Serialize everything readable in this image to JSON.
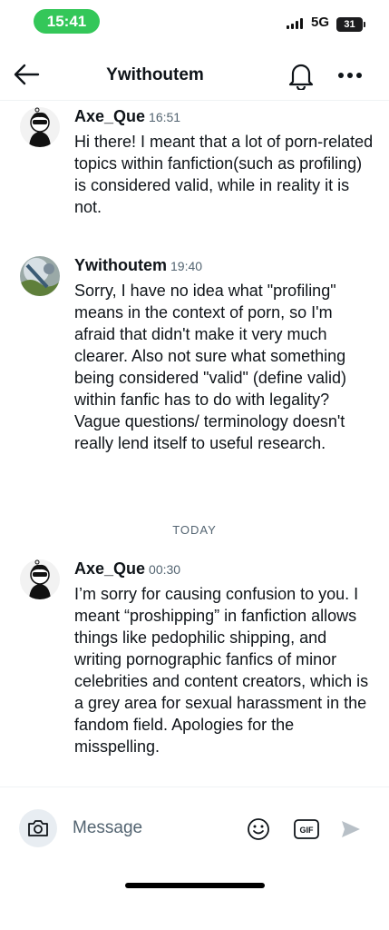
{
  "status_bar": {
    "time": "15:41",
    "network": "5G",
    "battery": "31"
  },
  "header": {
    "title": "Ywithoutem",
    "icons": [
      "back-arrow-icon",
      "bell-icon",
      "more-horizontal-icon"
    ]
  },
  "messages": [
    {
      "sender": "Axe_Que",
      "time": "16:51",
      "text": "Hi there! I meant that a lot of porn-related topics within fanfiction(such as profiling) is considered valid, while in reality it is not."
    },
    {
      "sender": "Ywithoutem",
      "time": "19:40",
      "text": "Sorry, I have no idea what \"profiling\" means in the context of porn, so I'm afraid that didn't make it very much clearer. Also not sure what something being considered \"valid\" (define valid) within fanfic has to do with legality? Vague questions/ terminology doesn't really lend itself to useful research."
    },
    {
      "sender": "Axe_Que",
      "time": "00:30",
      "text": "I’m sorry for causing confusion to you. I meant “proshipping” in fanfiction allows things like pedophilic shipping, and writing pornographic fanfics of minor celebrities and content creators, which is a grey area for sexual harassment in the fandom field. Apologies for the misspelling."
    }
  ],
  "divider": {
    "label": "TODAY"
  },
  "composer": {
    "placeholder": "Message",
    "icons": [
      "camera-icon",
      "emoji-icon",
      "gif-icon",
      "send-icon"
    ]
  },
  "colors": {
    "status_time_pill": "#34c759",
    "text_primary": "#0f1419",
    "text_secondary": "#536471",
    "send_disabled": "#b8c0c7"
  }
}
